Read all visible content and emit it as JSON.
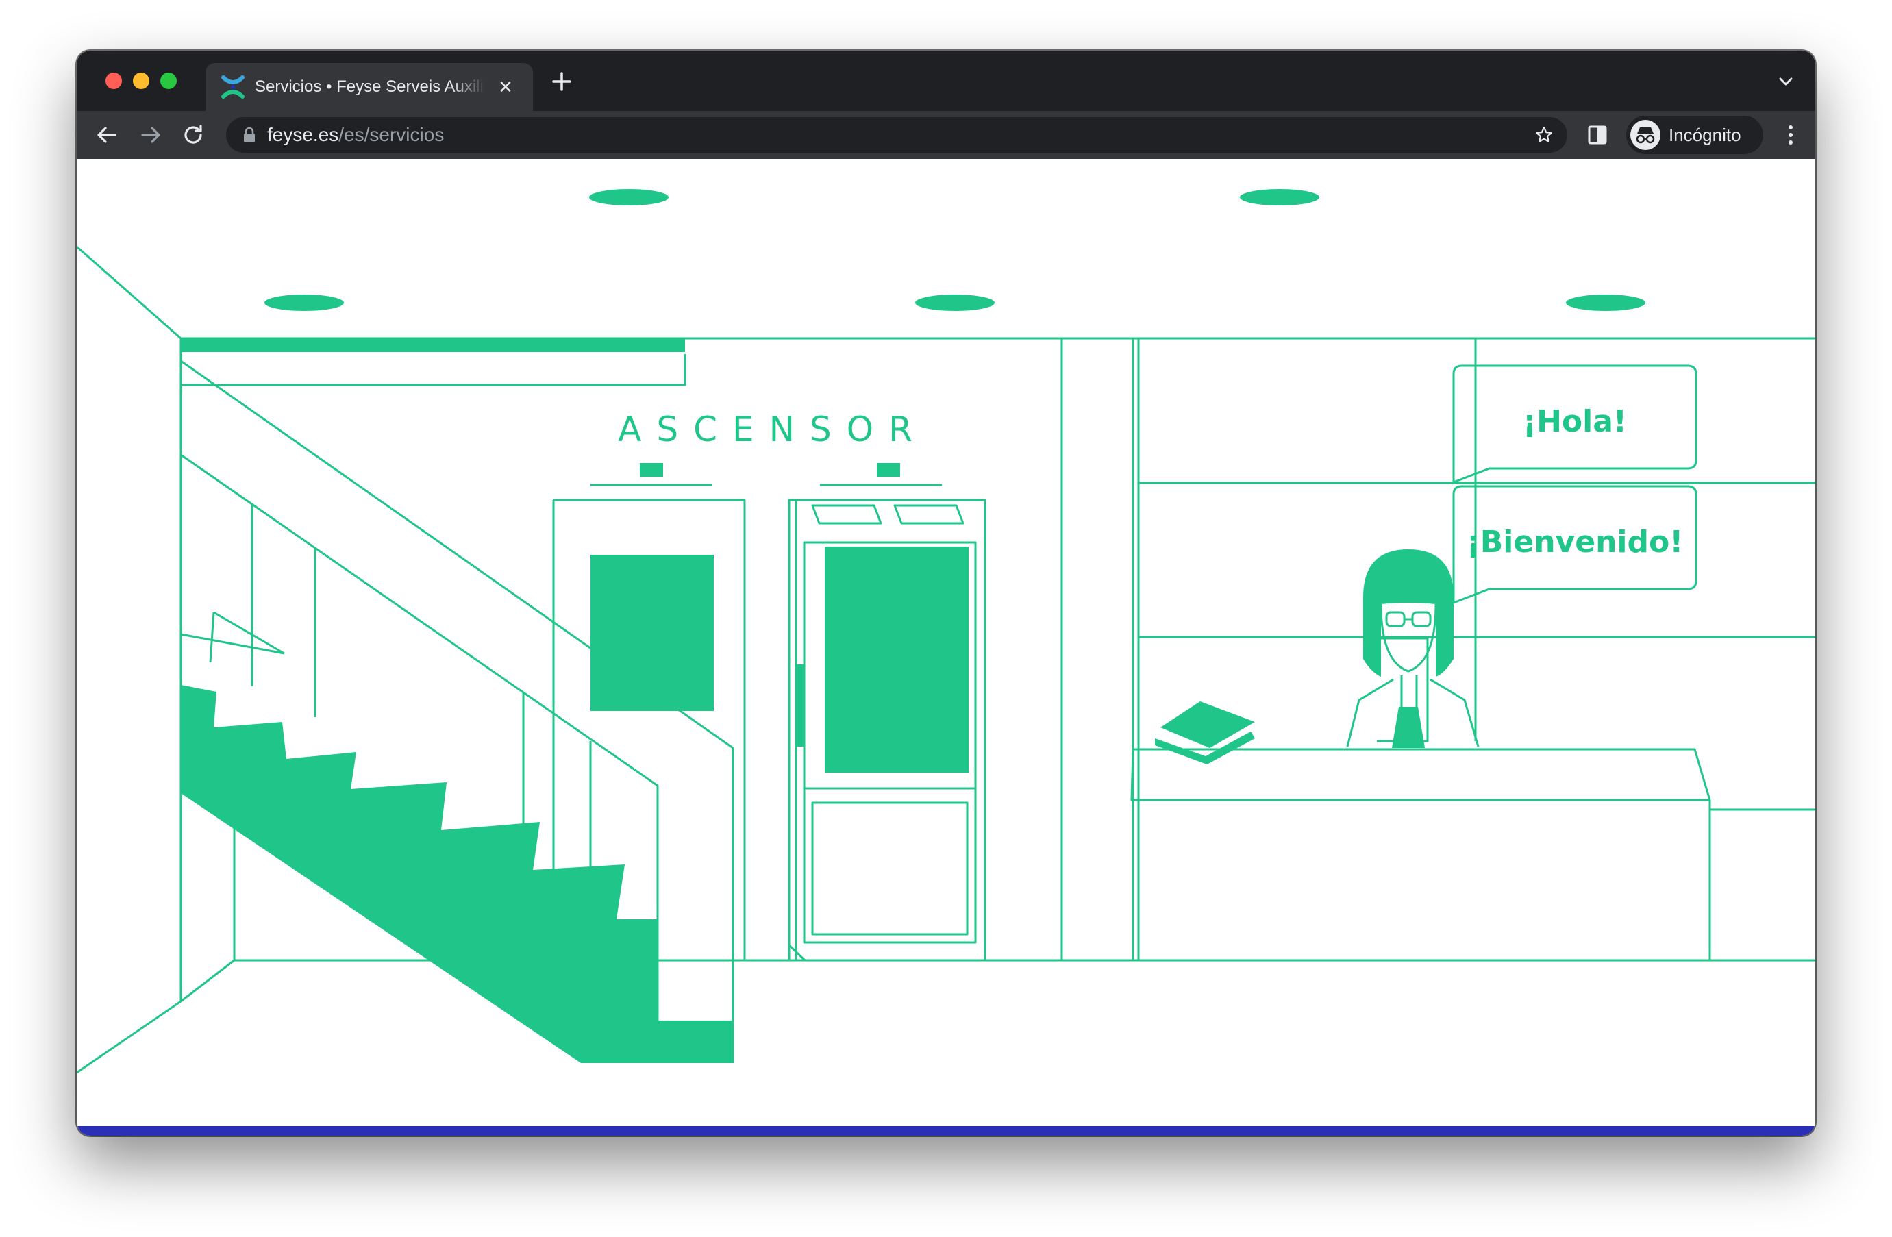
{
  "browser": {
    "tab": {
      "title": "Servicios • Feyse Serveis Auxiliars",
      "close_glyph": "✕",
      "favicon": "feyse-logo-icon"
    },
    "address_bar": {
      "host": "feyse.es",
      "path": "/es/servicios"
    },
    "profile_label": "Incógnito",
    "icons": [
      "back-arrow-icon",
      "forward-arrow-icon",
      "reload-icon",
      "lock-icon",
      "star-icon",
      "side-panel-icon",
      "incognito-icon",
      "kebab-menu-icon",
      "new-tab-icon",
      "tab-search-chevron-icon"
    ]
  },
  "page": {
    "elevator_sign": "ASCENSOR",
    "speech_bubbles": [
      "¡Hola!",
      "¡Bienvenido!"
    ]
  },
  "colors": {
    "accent_green": "#20c58a",
    "footer_bar": "#2b2fb5",
    "browser_frame": "#1f2023",
    "toolbar": "#35363a"
  }
}
